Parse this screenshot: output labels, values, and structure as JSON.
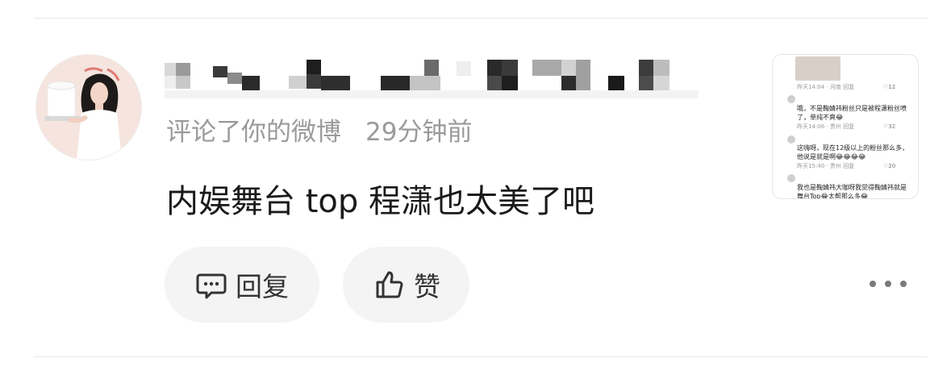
{
  "comment": {
    "meta_action": "评论了你的微博",
    "meta_time": "29分钟前",
    "content": "内娱舞台 top 程潇也太美了吧"
  },
  "actions": {
    "reply_label": "回复",
    "like_label": "赞"
  },
  "thumbnail": {
    "lines": [
      {
        "text": "哦，不是鞠婧祎粉丝只是被程潇粉丝喷",
        "meta": "",
        "likes": ""
      },
      {
        "text": "了，单纯不爽😂",
        "meta": "昨天14:06 · 贵州  回复",
        "likes": "♡32"
      },
      {
        "text": "这嗨呀，现在12级以上的粉丝那么多，",
        "meta": "",
        "likes": ""
      },
      {
        "text": "他说是就是啊😂😂😂😂",
        "meta": "昨天15:40 · 贵州  回复",
        "likes": "♡20"
      },
      {
        "text": "我也是鞠婧祎大咖呀我觉得鞠婧祎就是",
        "meta": "",
        "likes": ""
      },
      {
        "text": "舞台Top😂太帮那么多😂",
        "meta": "",
        "likes": ""
      }
    ],
    "first_meta": "昨天14:04 · 河南  回复",
    "first_likes": "♡12"
  },
  "colors": {
    "background": "#ffffff",
    "button_bg": "#f4f4f4",
    "meta_text": "#9a9a9a",
    "content_text": "#1a1a1a"
  },
  "icons": [
    "chat-bubble-icon",
    "thumbs-up-icon",
    "more-dots-icon"
  ]
}
